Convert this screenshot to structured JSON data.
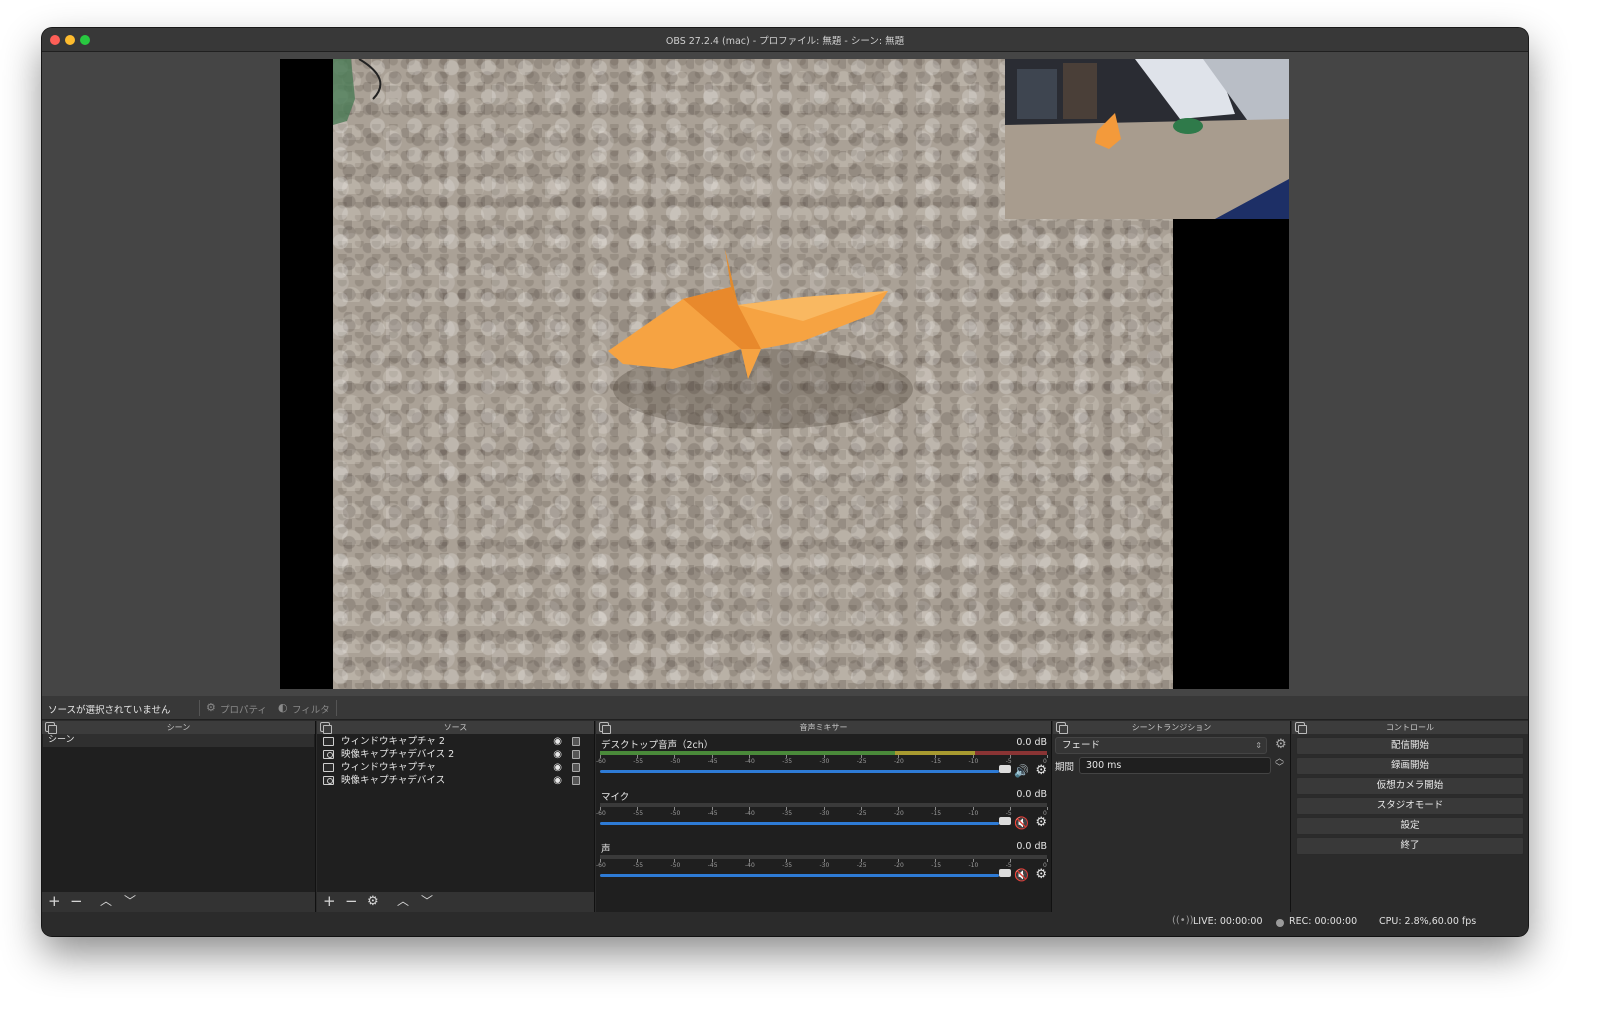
{
  "window": {
    "title": "OBS 27.2.4 (mac) - プロファイル: 無題 - シーン: 無題"
  },
  "toolbar": {
    "no_source": "ソースが選択されていません",
    "properties": "プロパティ",
    "filters": "フィルタ"
  },
  "scenes": {
    "header": "シーン",
    "items": [
      "シーン"
    ]
  },
  "sources": {
    "header": "ソース",
    "items": [
      {
        "name": "ウィンドウキャプチャ 2",
        "icon": "window-icon"
      },
      {
        "name": "映像キャプチャデバイス 2",
        "icon": "camera-icon"
      },
      {
        "name": "ウィンドウキャプチャ",
        "icon": "window-icon"
      },
      {
        "name": "映像キャプチャデバイス",
        "icon": "camera-icon"
      }
    ]
  },
  "mixer": {
    "header": "音声ミキサー",
    "channels": [
      {
        "name": "デスクトップ音声（2ch）",
        "db": "0.0 dB",
        "muted": false
      },
      {
        "name": "マイク",
        "db": "0.0 dB",
        "muted": true
      },
      {
        "name": "声",
        "db": "0.0 dB",
        "muted": true
      }
    ],
    "ticks": [
      "-60",
      "-55",
      "-50",
      "-45",
      "-40",
      "-35",
      "-30",
      "-25",
      "-20",
      "-15",
      "-10",
      "-5",
      "0"
    ]
  },
  "transitions": {
    "header": "シーントランジション",
    "selected": "フェード",
    "duration_label": "期間",
    "duration": "300 ms"
  },
  "controls": {
    "header": "コントロール",
    "buttons": [
      "配信開始",
      "録画開始",
      "仮想カメラ開始",
      "スタジオモード",
      "設定",
      "終了"
    ]
  },
  "status": {
    "live": "LIVE: 00:00:00",
    "rec": "REC: 00:00:00",
    "cpu": "CPU: 2.8%,60.00 fps"
  },
  "colors": {
    "accent": "#2e7bd6",
    "muted": "#e03030",
    "meter_green": "#4a8a3a",
    "meter_yellow": "#a89a30",
    "meter_red": "#8a3434"
  }
}
